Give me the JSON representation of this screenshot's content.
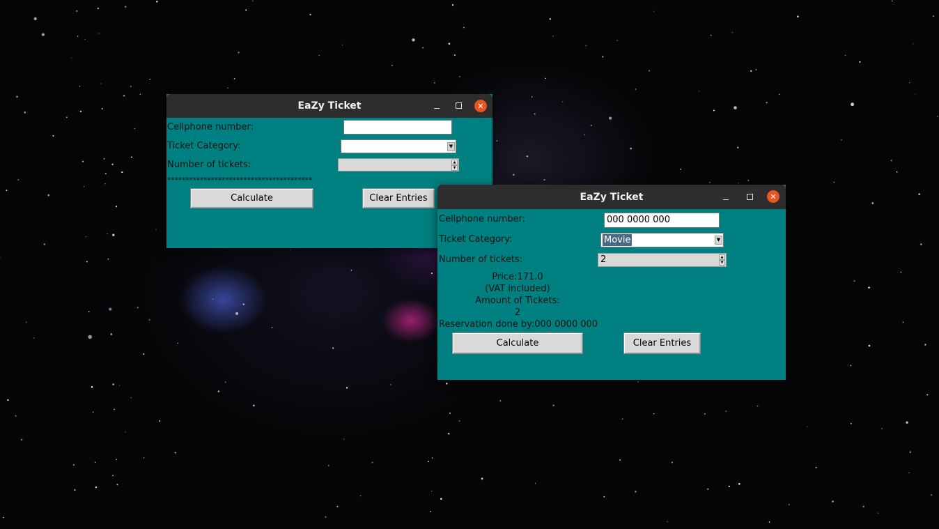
{
  "app_title": "EaZy Ticket",
  "window_controls": {
    "minimize": "–",
    "maximize": "□",
    "close": "✕"
  },
  "icons": {
    "minimize": "minimize-icon",
    "maximize": "maximize-icon",
    "close": "close-icon"
  },
  "colors": {
    "window_bg": "#008080",
    "titlebar_bg": "#2d2d2d",
    "close_button": "#e95420"
  },
  "window1": {
    "cellphone_label": "Cellphone number:",
    "cellphone_value": "",
    "category_label": "Ticket Category:",
    "category_value": "",
    "tickets_label": "Number of tickets:",
    "tickets_value": "",
    "separator": "****************************************",
    "calculate_label": "Calculate",
    "clear_label": "Clear Entries"
  },
  "window2": {
    "cellphone_label": "Cellphone number:",
    "cellphone_value": "000 0000 000",
    "category_label": "Ticket Category:",
    "category_value": "Movie",
    "tickets_label": "Number of tickets:",
    "tickets_value": "2",
    "result": {
      "price": "Price:171.0",
      "vat": "(VAT included)",
      "amount_label": "Amount of Tickets:",
      "amount_value": "2",
      "reservation": "Reservation done by:000 0000 000"
    },
    "calculate_label": "Calculate",
    "clear_label": "Clear Entries"
  }
}
